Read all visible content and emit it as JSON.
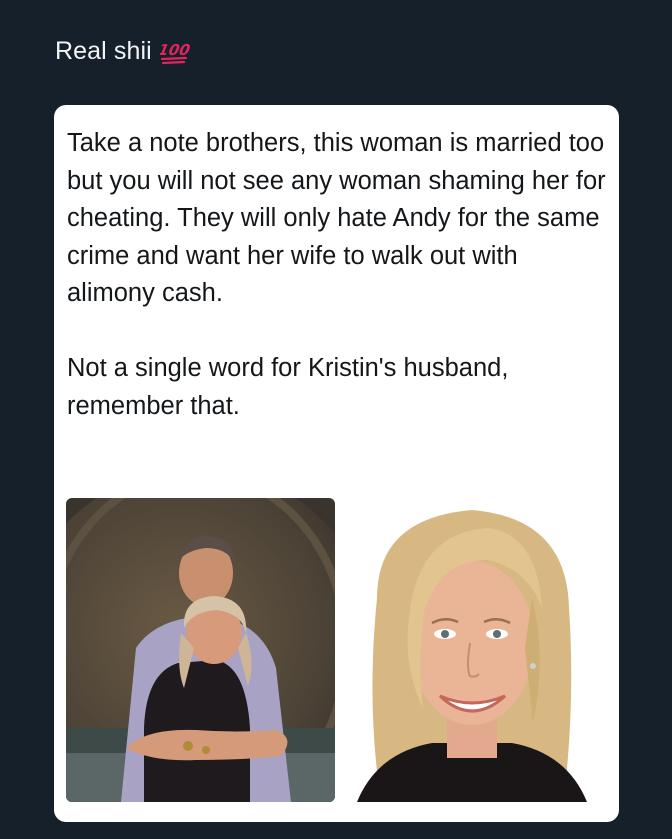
{
  "post": {
    "text": "Real shii",
    "emoji": "hundred-points-emoji"
  },
  "card": {
    "paragraphs": [
      "Take a note brothers, this woman is married too but you will not see any woman shaming her for cheating. They will only hate Andy for the same crime and want her wife to walk out with alimony cash.",
      "Not a single word for Kristin's husband, remember that."
    ],
    "images": [
      {
        "name": "couple-photo"
      },
      {
        "name": "woman-portrait-photo"
      }
    ]
  },
  "colors": {
    "background": "#15202b",
    "post_text": "#f2f4f6",
    "card_background": "#ffffff",
    "card_text": "#14171a",
    "emoji_red": "#e0245e"
  }
}
